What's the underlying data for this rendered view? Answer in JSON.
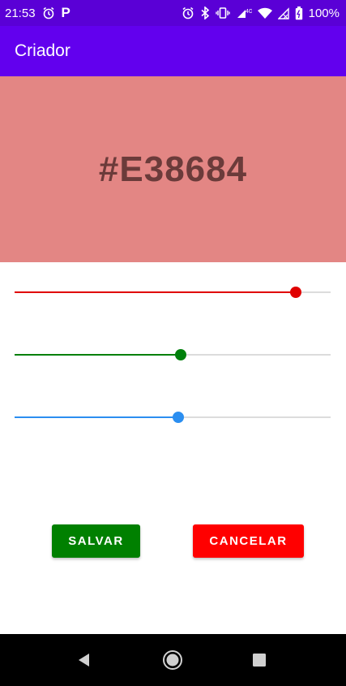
{
  "status_bar": {
    "time": "21:53",
    "battery": "100%",
    "network": "4G",
    "icons": [
      "alarm-icon",
      "p-icon",
      "alarm-icon",
      "bluetooth-icon",
      "vibrate-icon",
      "signal-icon",
      "wifi-icon",
      "no-signal-icon",
      "battery-icon"
    ],
    "p_glyph": "P"
  },
  "app_bar": {
    "title": "Criador"
  },
  "preview": {
    "hex": "#E38684",
    "background": "#E38684"
  },
  "sliders": [
    {
      "name": "red",
      "value": 227,
      "max": 255,
      "color": "#e00000"
    },
    {
      "name": "green",
      "value": 134,
      "max": 255,
      "color": "#00800b"
    },
    {
      "name": "blue",
      "value": 132,
      "max": 255,
      "color": "#2b8ef0"
    }
  ],
  "buttons": {
    "save": {
      "label": "SALVAR",
      "color": "#008000"
    },
    "cancel": {
      "label": "CANCELAR",
      "color": "#ff0000"
    }
  },
  "nav_bar": {
    "icons": [
      "back-icon",
      "home-icon",
      "recents-icon"
    ]
  }
}
